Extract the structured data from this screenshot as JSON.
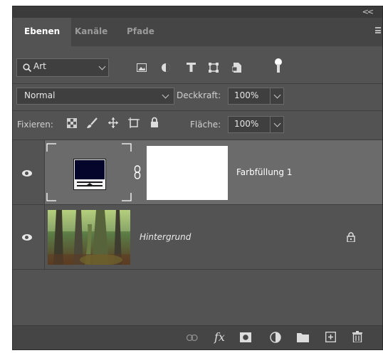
{
  "window": {
    "collapse_label": "<<"
  },
  "tabs": [
    {
      "label": "Ebenen",
      "active": true
    },
    {
      "label": "Kanäle",
      "active": false
    },
    {
      "label": "Pfade",
      "active": false
    }
  ],
  "filter": {
    "label": "Art",
    "icons": [
      "image-filter-icon",
      "adjustment-filter-icon",
      "type-filter-icon",
      "shape-filter-icon",
      "smart-object-filter-icon",
      "filter-toggle-icon"
    ]
  },
  "blend": {
    "mode": "Normal",
    "opacity_label": "Deckkraft:",
    "opacity_value": "100%"
  },
  "lock": {
    "label": "Fixieren:",
    "fill_label": "Fläche:",
    "fill_value": "100%"
  },
  "layers": [
    {
      "name": "Farbfüllung 1",
      "visible": true,
      "selected": true,
      "fill_color": "#05042a",
      "mask_color": "#ffffff"
    },
    {
      "name": "Hintergrund",
      "visible": true,
      "selected": false,
      "italic": true,
      "locked": true
    }
  ],
  "bottom_bar": {
    "fx_label": "fx",
    "icons": [
      "link-layers-icon",
      "fx-icon",
      "add-mask-icon",
      "adjustment-layer-icon",
      "new-group-icon",
      "new-layer-icon",
      "delete-icon"
    ]
  },
  "colors": {
    "panel": "#535353",
    "selected_row": "#6b6b6b",
    "tab_bar": "#454545",
    "fill_swatch": "#05042a"
  }
}
